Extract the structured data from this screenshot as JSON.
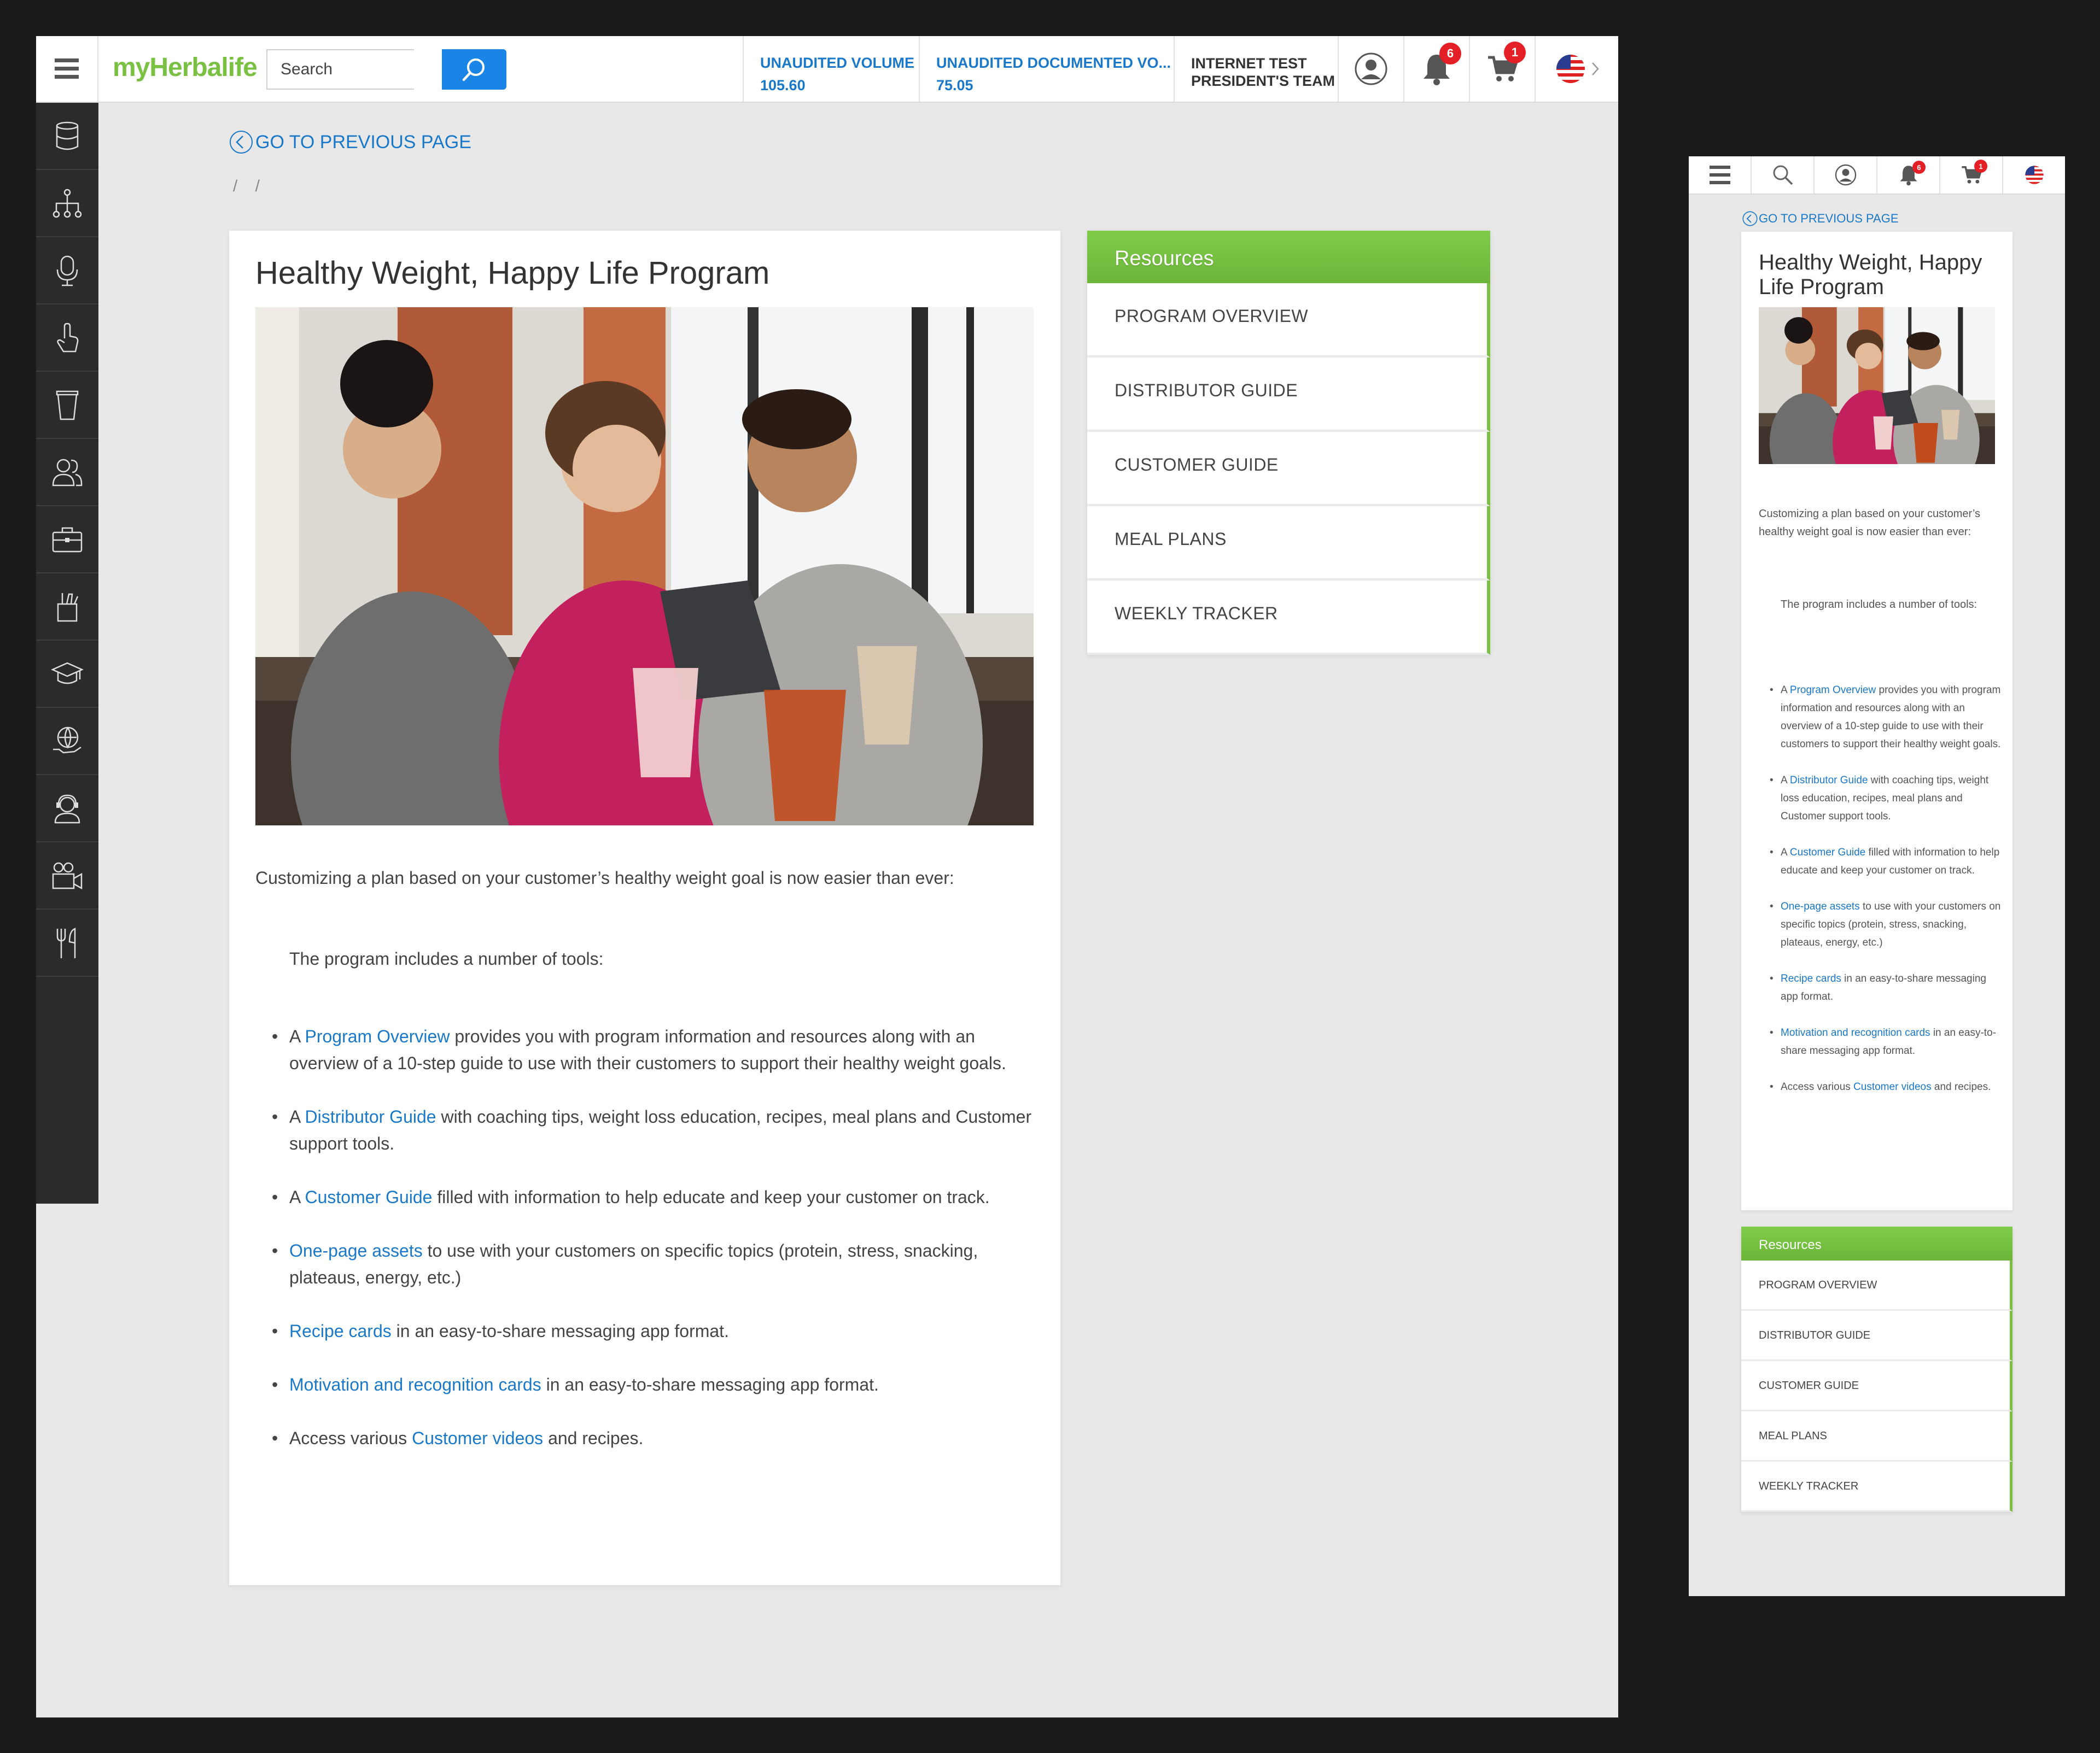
{
  "header": {
    "logo": "myHerbalife",
    "search_placeholder": "Search",
    "stats": [
      {
        "label": "UNAUDITED VOLUME",
        "value": "105.60"
      },
      {
        "label": "UNAUDITED DOCUMENTED VO...",
        "value": "75.05"
      }
    ],
    "account": {
      "line1": "INTERNET TEST",
      "line2": "PRESIDENT'S TEAM"
    },
    "notifications_count": "6",
    "cart_count": "1"
  },
  "sidebar": {
    "icons": [
      "database-icon",
      "network-icon",
      "microphone-icon",
      "touch-icon",
      "cup-icon",
      "users-icon",
      "briefcase-icon",
      "tools-icon",
      "graduation-cap-icon",
      "globe-hand-icon",
      "support-agent-icon",
      "video-camera-icon",
      "fork-knife-icon"
    ]
  },
  "nav": {
    "back_label": "GO TO PREVIOUS PAGE",
    "breadcrumb": "/ /"
  },
  "article": {
    "title": "Healthy Weight, Happy Life Program",
    "intro": "Customizing a plan based on your customer’s healthy weight goal is now easier than ever:",
    "tools_intro": "The program includes a number of tools:",
    "items": [
      {
        "pre": "A ",
        "link": "Program Overview",
        "post": " provides you with program information and resources along with an overview of a 10-step guide to use with their customers to support their healthy weight goals."
      },
      {
        "pre": "A ",
        "link": "Distributor Guide",
        "post": " with coaching tips, weight loss education, recipes, meal plans and Customer support tools."
      },
      {
        "pre": "A ",
        "link": "Customer Guide",
        "post": " filled with information to help educate and keep your customer on track."
      },
      {
        "pre": "",
        "link": "One-page assets",
        "post": " to use with your customers on specific topics (protein, stress, snacking, plateaus, energy, etc.)"
      },
      {
        "pre": "",
        "link": "Recipe cards",
        "post": " in an easy-to-share messaging app format."
      },
      {
        "pre": "",
        "link": "Motivation and recognition cards",
        "post": " in an easy-to-share messaging app format."
      },
      {
        "pre": "Access various ",
        "link": "Customer videos",
        "post": " and recipes."
      }
    ]
  },
  "resources": {
    "title": "Resources",
    "items": [
      "PROGRAM OVERVIEW",
      "DISTRIBUTOR GUIDE",
      "CUSTOMER GUIDE",
      "MEAL PLANS",
      "WEEKLY TRACKER"
    ]
  },
  "colors": {
    "brand_green": "#7ac143",
    "link_blue": "#1a78c8",
    "badge_red": "#e41f26"
  }
}
